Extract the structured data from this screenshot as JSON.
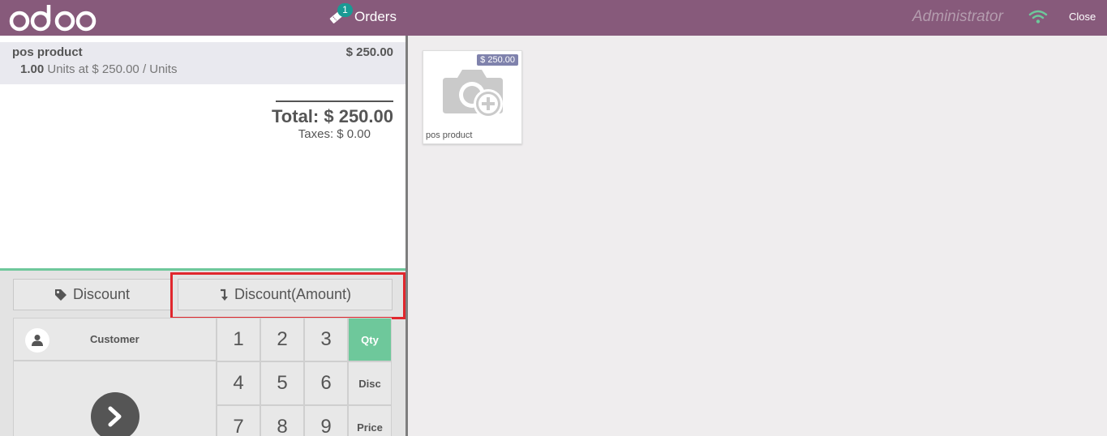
{
  "header": {
    "logo": "odoo",
    "orders_count": "1",
    "orders_label": "Orders",
    "user": "Administrator",
    "close_label": "Close",
    "wifi_color": "#6ec89b"
  },
  "orderline": {
    "name": "pos product",
    "price": "$ 250.00",
    "qty": "1.00",
    "info": " Units at $ 250.00 / Units"
  },
  "summary": {
    "total": "Total: $ 250.00",
    "taxes": "Taxes: $ 0.00"
  },
  "controls": {
    "discount_label": "Discount",
    "discount_icon": "tag-icon",
    "discount_amount_label": "Discount(Amount)",
    "discount_amount_icon": "arrow-turn-down-icon",
    "highlight_color": "#e0272d"
  },
  "actionpad": {
    "customer_label": "Customer",
    "customer_icon": "user-icon",
    "payment_icon": "chevron-right-icon"
  },
  "numpad": {
    "keys": [
      {
        "label": "1"
      },
      {
        "label": "2"
      },
      {
        "label": "3"
      },
      {
        "label": "Qty",
        "active": true
      },
      {
        "label": "4"
      },
      {
        "label": "5"
      },
      {
        "label": "6"
      },
      {
        "label": "Disc"
      },
      {
        "label": "7"
      },
      {
        "label": "8"
      },
      {
        "label": "9"
      },
      {
        "label": "Price"
      }
    ],
    "active_color": "#6ec89b"
  },
  "products": [
    {
      "name": "pos product",
      "price": "$ 250.00",
      "image_icon": "camera-add-icon"
    }
  ],
  "colors": {
    "brand": "#875a7b",
    "accent": "#6ec89b",
    "price_tag": "#7f82ac"
  }
}
